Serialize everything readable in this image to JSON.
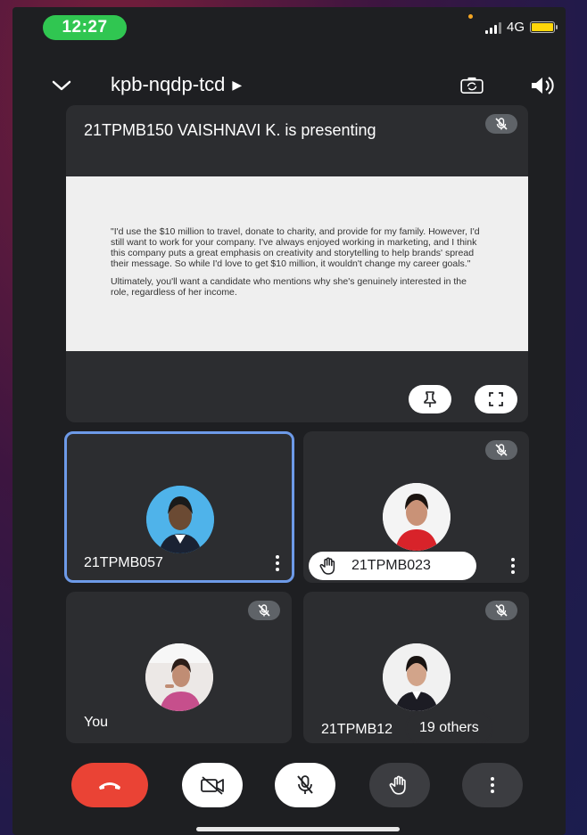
{
  "status_bar": {
    "time": "12:27",
    "network": "4G"
  },
  "header": {
    "meeting_code": "kpb-nqdp-tcd"
  },
  "presentation": {
    "title": "21TPMB150 VAISHNAVI K. is presenting",
    "slide_paragraph_1": "\"I'd use the $10 million to travel, donate to charity, and provide for my family. However, I'd still want to work for your company. I've always enjoyed working in marketing, and I think this company puts a great emphasis on creativity and storytelling to help brands' spread their message. So while I'd love to get $10 million, it wouldn't change my career goals.\"",
    "slide_paragraph_2": "Ultimately, you'll want a candidate who mentions why she's genuinely interested in the role, regardless of her income."
  },
  "tiles": [
    {
      "name": "21TPMB057",
      "active": true
    },
    {
      "name": "21TPMB023",
      "hand_raised": true
    },
    {
      "name": "You"
    },
    {
      "name": "21TPMB12",
      "others_label": "19 others"
    }
  ],
  "colors": {
    "end_call": "#ea4335",
    "active_border": "#6d9ae8",
    "clock_pill": "#30c651"
  },
  "icons": [
    "chevron-down-icon",
    "camera-switch-icon",
    "speaker-icon",
    "mic-off-icon",
    "pin-icon",
    "fullscreen-icon",
    "more-vert-icon",
    "raise-hand-icon",
    "end-call-icon",
    "video-off-icon"
  ]
}
